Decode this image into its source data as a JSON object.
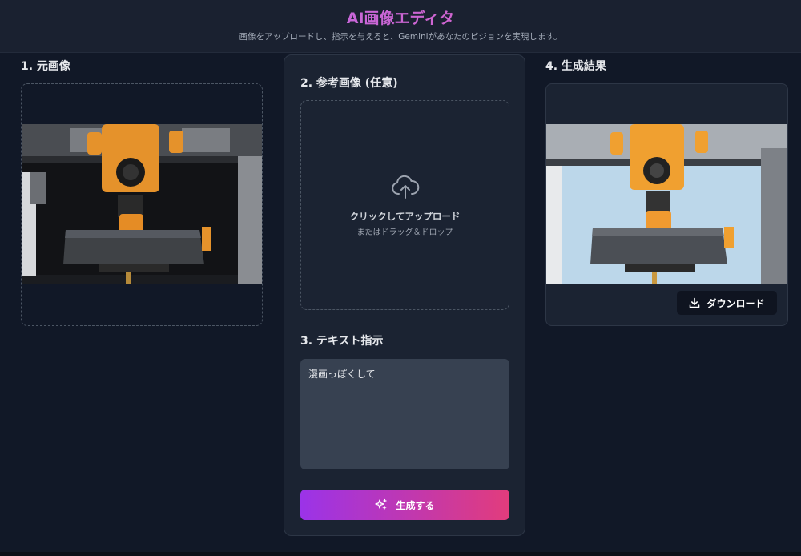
{
  "header": {
    "title": "AI画像エディタ",
    "subtitle": "画像をアップロードし、指示を与えると、Geminiがあなたのビジョンを実現します。"
  },
  "sections": {
    "original": {
      "title": "1. 元画像"
    },
    "reference": {
      "title": "2. 参考画像 (任意)",
      "upload_label": "クリックしてアップロード",
      "upload_hint": "またはドラッグ＆ドロップ"
    },
    "instruction": {
      "title": "3. テキスト指示",
      "value": "漫画っぽくして"
    },
    "result": {
      "title": "4. 生成結果"
    }
  },
  "buttons": {
    "generate": "生成する",
    "download": "ダウンロード"
  },
  "icons": {
    "upload": "cloud-upload-icon",
    "generate": "sparkles-icon",
    "download": "download-icon"
  },
  "colors": {
    "background": "#111827",
    "card": "#1b2332",
    "accent_start": "#9b33e8",
    "accent_end": "#e23c7c"
  }
}
